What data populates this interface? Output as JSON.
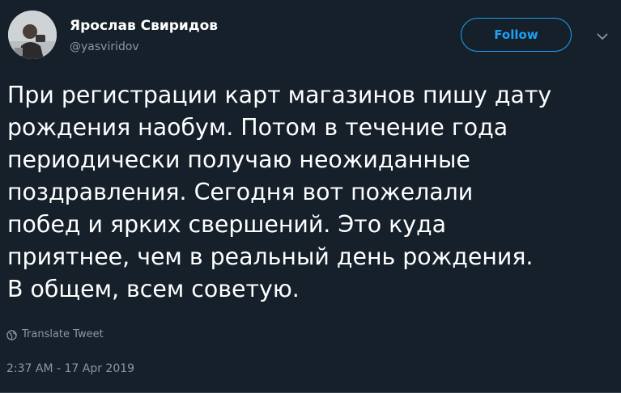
{
  "author": {
    "display_name": "Ярослав Свиридов",
    "handle": "@yasviridov",
    "avatar_icon": "profile-photo"
  },
  "actions": {
    "follow_label": "Follow",
    "more_icon": "chevron-down-icon"
  },
  "tweet": {
    "lines": [
      "При регистрации карт магазинов пишу дату",
      "рождения наобум. Потом в течение года",
      "периодически получаю неожиданные",
      "поздравления. Сегодня вот пожелали",
      "побед и ярких свершений. Это куда",
      "приятнее, чем в реальный день рождения.",
      "В общем, всем советую."
    ],
    "translate_label": "Translate Tweet",
    "translate_icon": "globe-icon",
    "timestamp": "2:37 AM - 17 Apr 2019"
  },
  "colors": {
    "background": "#15202b",
    "text_primary": "#ffffff",
    "text_secondary": "#8899a6",
    "accent": "#1da1f2",
    "divider": "#38444d"
  }
}
